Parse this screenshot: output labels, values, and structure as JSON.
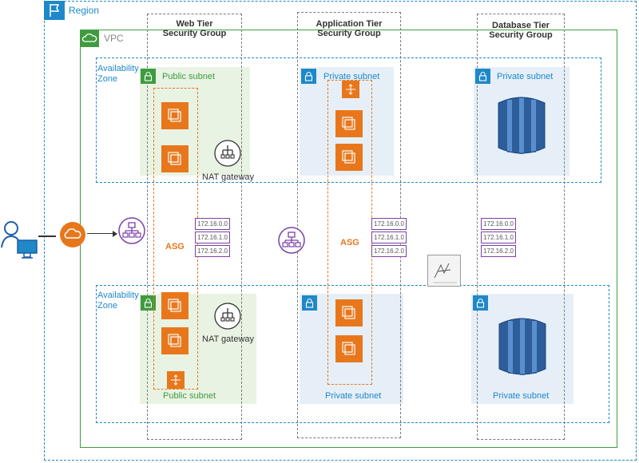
{
  "region": {
    "label": "Region"
  },
  "vpc": {
    "label": "VPC"
  },
  "availability_zone_label": "Availability\nZone",
  "security_groups": {
    "web": "Web Tier\nSecurity Group",
    "app": "Application Tier\nSecurity Group",
    "db": "Database Tier\nSecurity Group"
  },
  "subnets": {
    "public": "Public subnet",
    "private": "Private subnet"
  },
  "asg_label": "ASG",
  "nat_gateway_label": "NAT gateway",
  "cidr_blocks": [
    "172.16.0.0",
    "172.16.1.0",
    "172.16.2.0"
  ],
  "cidr_blocks_app": [
    "172.16.0.0",
    "172.16.1.0",
    "172.16.2.0"
  ],
  "colors": {
    "region": "#1e88c8",
    "vpc": "#3f9b3f",
    "ec2": "#e8771c",
    "cidr": "#7b42a6",
    "load_balancer": "#7b42a6",
    "database": "#2d5d9a"
  },
  "icons": [
    "user-icon",
    "internet-gateway-icon",
    "load-balancer-icon",
    "ec2-instance-icon",
    "nat-gateway-icon",
    "rds-database-icon",
    "lock-icon",
    "region-flag-icon",
    "cloud-icon"
  ]
}
